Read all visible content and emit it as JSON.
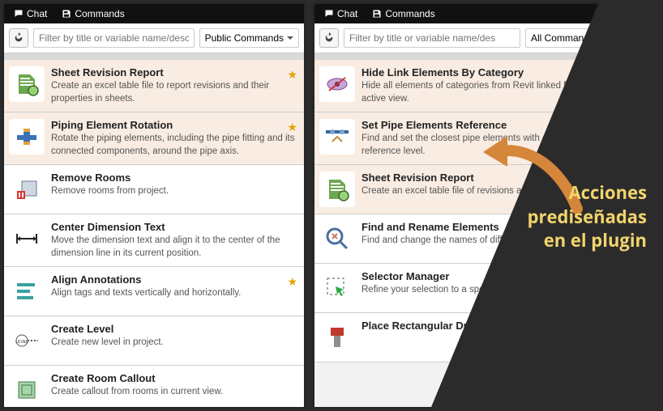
{
  "tabs": {
    "chat": "Chat",
    "commands": "Commands"
  },
  "left": {
    "filter_placeholder": "Filter by title or variable name/description",
    "selector": "Public Commands",
    "cmds": [
      {
        "title": "Sheet Revision Report",
        "desc": "Create an excel table file to report revisions and their properties in sheets.",
        "star": true
      },
      {
        "title": "Piping Element Rotation",
        "desc": "Rotate the piping elements, including the pipe fitting and its connected components, around the pipe axis.",
        "star": true
      },
      {
        "title": "Remove Rooms",
        "desc": "Remove rooms from project.",
        "star": false
      },
      {
        "title": "Center Dimension Text",
        "desc": "Move the dimension text and align it to the center of the dimension line in its current position.",
        "star": false
      },
      {
        "title": "Align Annotations",
        "desc": "Align tags and texts vertically and horizontally.",
        "star": true
      },
      {
        "title": "Create Level",
        "desc": "Create new level in project.",
        "star": false
      },
      {
        "title": "Create Room Callout",
        "desc": "Create callout from rooms in current view.",
        "star": false
      }
    ]
  },
  "right": {
    "filter_placeholder": "Filter by title or variable name/des",
    "selector": "All Commands",
    "cmds": [
      {
        "title": "Hide Link Elements By Category",
        "desc": "Hide all elements of categories from Revit linked files in the active view.",
        "star": false
      },
      {
        "title": "Set Pipe Elements Reference",
        "desc": "Find and set the closest pipe elements with certain reference level.",
        "star": false
      },
      {
        "title": "Sheet Revision Report",
        "desc": "Create an excel table file of revisions and their properties.",
        "star": true
      },
      {
        "title": "Find and Rename Elements",
        "desc": "Find and change the names of different types and families.",
        "star": false
      },
      {
        "title": "Selector Manager",
        "desc": "Refine your selection to a specified set of elements.",
        "star": false
      },
      {
        "title": "Place Rectangular Ducts at Walls",
        "desc": "",
        "star": false
      }
    ]
  },
  "annotation": {
    "l1": "Acciones",
    "l2": "prediseñadas",
    "l3": "en el plugin"
  }
}
